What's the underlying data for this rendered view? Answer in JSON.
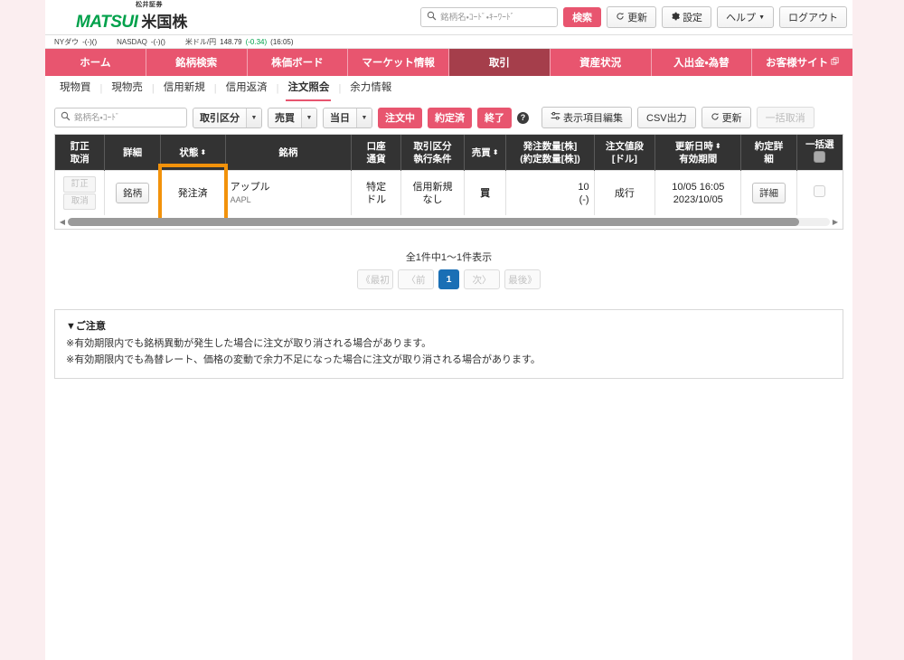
{
  "header": {
    "logo_sub": "松井証券",
    "logo_main": "MATSUI",
    "logo_jp": "米国株",
    "search_placeholder": "銘柄名・ｺｰﾄﾞ・ｷｰﾜｰﾄﾞ",
    "search_value": "",
    "search_button": "検索",
    "refresh_button": "更新",
    "settings_button": "設定",
    "help_button": "ヘルプ",
    "logout_button": "ログアウト",
    "accent_pink": "#e8556f",
    "accent_green": "#00a14b"
  },
  "ticker": [
    {
      "name": "NYダウ",
      "value": "-(-)()"
    },
    {
      "name": "NASDAQ",
      "value": "-(-)()"
    },
    {
      "name": "米ドル/円",
      "value": "148.79",
      "change": "(-0.34)",
      "time": "(16:05)"
    }
  ],
  "nav": [
    {
      "label": "ホーム",
      "active": false
    },
    {
      "label": "銘柄検索",
      "active": false
    },
    {
      "label": "株価ボード",
      "active": false
    },
    {
      "label": "マーケット情報",
      "active": false
    },
    {
      "label": "取引",
      "active": true
    },
    {
      "label": "資産状況",
      "active": false
    },
    {
      "label": "入出金・為替",
      "active": false
    },
    {
      "label": "お客様サイト",
      "active": false,
      "external": true
    }
  ],
  "subnav": [
    {
      "label": "現物買",
      "active": false
    },
    {
      "label": "現物売",
      "active": false
    },
    {
      "label": "信用新規",
      "active": false
    },
    {
      "label": "信用返済",
      "active": false
    },
    {
      "label": "注文照会",
      "active": true
    },
    {
      "label": "余力情報",
      "active": false
    }
  ],
  "toolbar": {
    "search_placeholder": "銘柄名・ｺｰﾄﾞ",
    "search_value": "",
    "select_trade_type": "取引区分",
    "select_buy_sell": "売買",
    "select_period": "当日",
    "filter_ordering": "注文中",
    "filter_executed": "約定済",
    "filter_finished": "終了",
    "help_icon": "?",
    "edit_columns": "表示項目編集",
    "csv_export": "CSV出力",
    "refresh": "更新",
    "bulk_cancel": "一括取消"
  },
  "table": {
    "columns": [
      {
        "line1": "訂正",
        "line2": "取消",
        "sortable": false
      },
      {
        "line1": "詳細",
        "line2": "",
        "sortable": false
      },
      {
        "line1": "状態",
        "line2": "",
        "sortable": true
      },
      {
        "line1": "銘柄",
        "line2": "",
        "sortable": false
      },
      {
        "line1": "口座",
        "line2": "通貨",
        "sortable": false
      },
      {
        "line1": "取引区分",
        "line2": "執行条件",
        "sortable": false
      },
      {
        "line1": "売買",
        "line2": "",
        "sortable": true
      },
      {
        "line1": "発注数量[株]",
        "line2": "(約定数量[株])",
        "sortable": false
      },
      {
        "line1": "注文値段",
        "line2": "[ドル]",
        "sortable": false
      },
      {
        "line1": "更新日時",
        "line2": "有効期間",
        "sortable": true
      },
      {
        "line1": "約定詳",
        "line2": "細",
        "sortable": false
      },
      {
        "line1": "一括選",
        "line2": "",
        "sortable": false,
        "checkbox": true
      }
    ],
    "rows": [
      {
        "edit": "訂正",
        "cancel": "取消",
        "detail_button": "銘柄",
        "status": "発注済",
        "status_highlighted": true,
        "highlight_color": "#f2920b",
        "name": "アップル",
        "ticker": "AAPL",
        "account": "特定",
        "currency": "ドル",
        "trade_type": "信用新規",
        "exec_cond": "なし",
        "side": "買",
        "qty": "10",
        "exec_qty": "(-)",
        "price": "成行",
        "updated": "10/05 16:05",
        "valid_until": "2023/10/05",
        "exec_detail_button": "詳細",
        "checked": false
      }
    ]
  },
  "pagination": {
    "count_text": "全1件中1～1件表示",
    "first": "《最初",
    "prev": "〈前",
    "current": "1",
    "next": "次〉",
    "last": "最後》"
  },
  "notice": {
    "title": "▼ご注意",
    "lines": [
      "※有効期限内でも銘柄異動が発生した場合に注文が取り消される場合があります。",
      "※有効期限内でも為替レート、価格の変動で余力不足になった場合に注文が取り消される場合があります。"
    ]
  }
}
